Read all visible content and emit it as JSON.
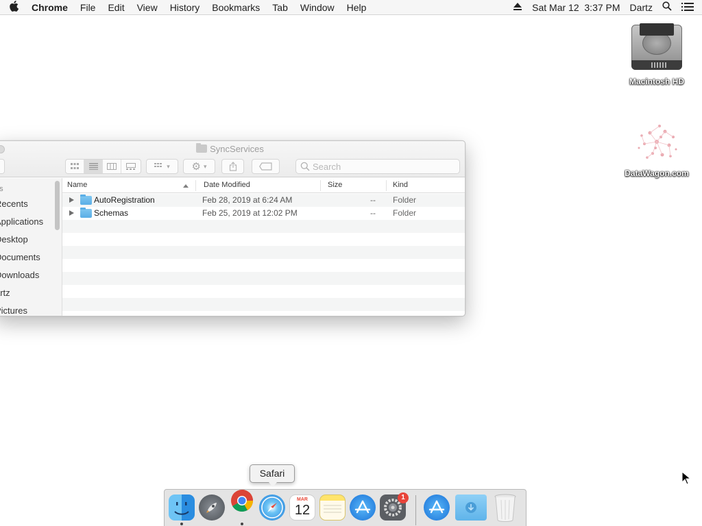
{
  "menubar": {
    "apple_icon": "apple-icon",
    "app_name": "Chrome",
    "menus": [
      "File",
      "Edit",
      "View",
      "History",
      "Bookmarks",
      "Tab",
      "Window",
      "Help"
    ],
    "datetime": "Sat Mar 12  3:37 PM",
    "user": "Dartz"
  },
  "desktop": {
    "icons": [
      {
        "label": "Macintosh HD",
        "icon": "hard-drive-icon"
      },
      {
        "label": "DataWagon.com",
        "icon": "datawagon-icon"
      }
    ]
  },
  "finder": {
    "title": "SyncServices",
    "search_placeholder": "Search",
    "sidebar": {
      "section": "es",
      "items": [
        "Recents",
        "Applications",
        "Desktop",
        "Documents",
        "Downloads",
        "artz",
        "Pictures"
      ]
    },
    "columns": {
      "name": "Name",
      "date": "Date Modified",
      "size": "Size",
      "kind": "Kind"
    },
    "rows": [
      {
        "name": "AutoRegistration",
        "date": "Feb 28, 2019 at 6:24 AM",
        "size": "--",
        "kind": "Folder"
      },
      {
        "name": "Schemas",
        "date": "Feb 25, 2019 at 12:02 PM",
        "size": "--",
        "kind": "Folder"
      }
    ]
  },
  "dock": {
    "tooltip": "Safari",
    "calendar_month": "MAR",
    "calendar_day": "12",
    "system_prefs_badge": "1",
    "apps": [
      "Finder",
      "Launchpad",
      "Chrome",
      "Safari",
      "Calendar",
      "Notes",
      "App Store",
      "System Preferences",
      "App Store",
      "Downloads",
      "Trash"
    ]
  },
  "colors": {
    "menubar_bg": "#f6f6f6",
    "folder_blue": "#5aaee6",
    "badge_red": "#e8443a"
  }
}
